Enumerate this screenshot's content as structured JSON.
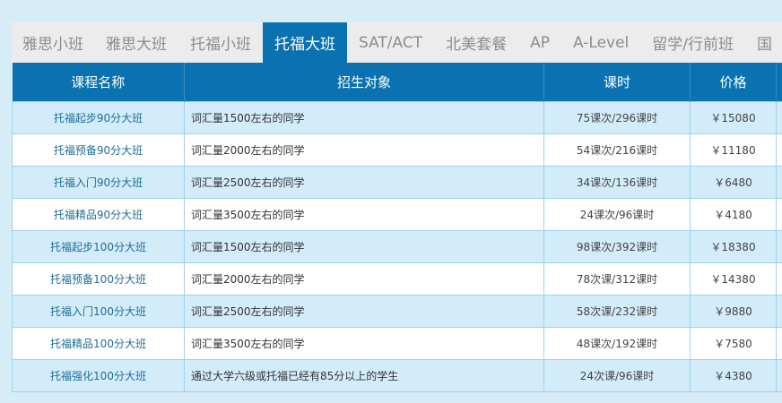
{
  "tabs": [
    {
      "label": "雅思小班",
      "active": false
    },
    {
      "label": "雅思大班",
      "active": false
    },
    {
      "label": "托福小班",
      "active": false
    },
    {
      "label": "托福大班",
      "active": true
    },
    {
      "label": "SAT/ACT",
      "active": false
    },
    {
      "label": "北美套餐",
      "active": false
    },
    {
      "label": "AP",
      "active": false
    },
    {
      "label": "A-Level",
      "active": false
    },
    {
      "label": "留学/行前班",
      "active": false
    },
    {
      "label": "国",
      "active": false
    }
  ],
  "table": {
    "headers": {
      "name": "课程名称",
      "target": "招生对象",
      "hours": "课时",
      "price": "价格"
    },
    "rows": [
      {
        "name": "托福起步90分大班",
        "target": "词汇量1500左右的同学",
        "hours": "75课次/296课时",
        "price": "￥15080"
      },
      {
        "name": "托福预备90分大班",
        "target": "词汇量2000左右的同学",
        "hours": "54课次/216课时",
        "price": "￥11180"
      },
      {
        "name": "托福入门90分大班",
        "target": "词汇量2500左右的同学",
        "hours": "34课次/136课时",
        "price": "￥6480"
      },
      {
        "name": "托福精品90分大班",
        "target": "词汇量3500左右的同学",
        "hours": "24课次/96课时",
        "price": "￥4180"
      },
      {
        "name": "托福起步100分大班",
        "target": "词汇量1500左右的同学",
        "hours": "98课次/392课时",
        "price": "￥18380"
      },
      {
        "name": "托福预备100分大班",
        "target": "词汇量2000左右的同学",
        "hours": "78次课/312课时",
        "price": "￥14380"
      },
      {
        "name": "托福入门100分大班",
        "target": "词汇量2500左右的同学",
        "hours": "58次课/232课时",
        "price": "￥9880"
      },
      {
        "name": "托福精品100分大班",
        "target": "词汇量3500左右的同学",
        "hours": "48课次/192课时",
        "price": "￥7580"
      },
      {
        "name": "托福强化100分大班",
        "target": "通过大学六级或托福已经有85分以上的学生",
        "hours": "24次课/96课时",
        "price": "￥4380"
      }
    ]
  },
  "colors": {
    "tab_active_bg": "#0a72b0",
    "header_bg": "#0a72b0",
    "row_odd_bg": "#d2ecfa",
    "row_even_bg": "#ffffff",
    "tab_bar_bg": "#ececec"
  }
}
